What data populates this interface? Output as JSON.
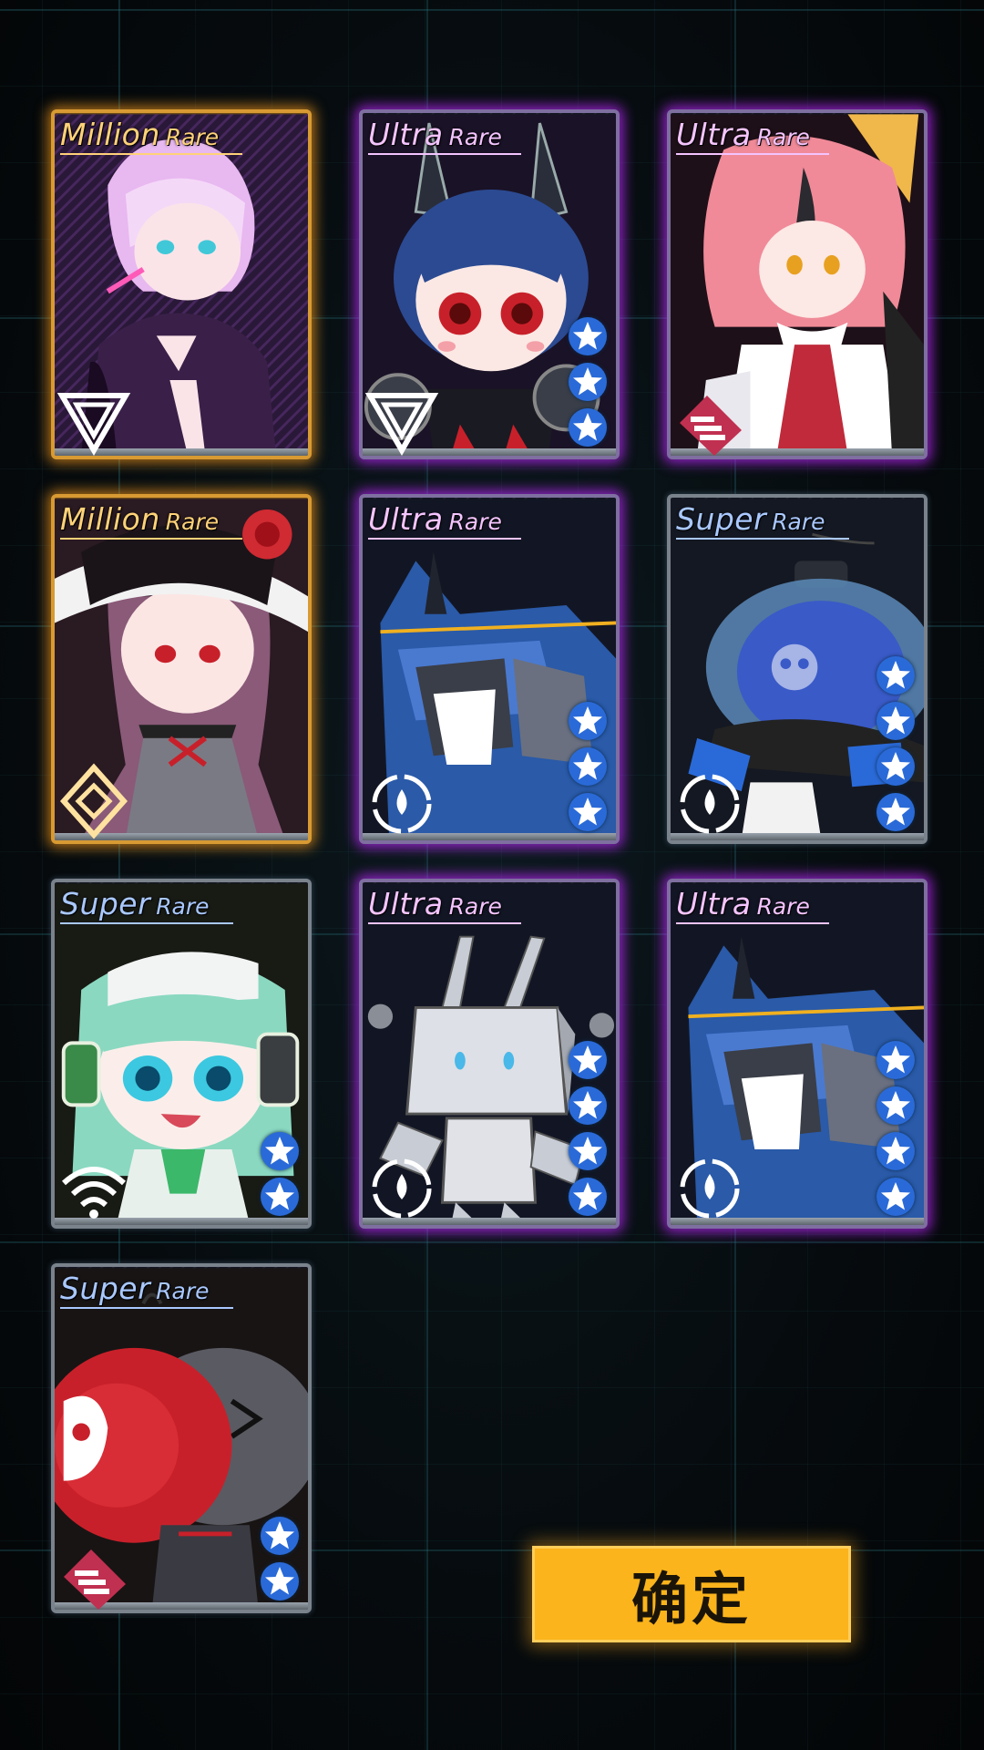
{
  "cards": [
    {
      "rarity_main": "Million",
      "rarity_suffix": "Rare",
      "tier": "million",
      "stars": 0,
      "class_icon": "triangle-class-icon",
      "character": "purple-hair-girl"
    },
    {
      "rarity_main": "Ultra",
      "rarity_suffix": "Rare",
      "tier": "ultra",
      "stars": 3,
      "class_icon": "triangle-class-icon",
      "character": "blue-hair-bunny-girl"
    },
    {
      "rarity_main": "Ultra",
      "rarity_suffix": "Rare",
      "tier": "ultra",
      "stars": 0,
      "class_icon": "stripes-class-icon",
      "character": "pink-hair-fox-girl"
    },
    {
      "rarity_main": "Million",
      "rarity_suffix": "Rare",
      "tier": "million",
      "stars": 0,
      "class_icon": "diamond-class-icon",
      "character": "witch-hat-girl"
    },
    {
      "rarity_main": "Ultra",
      "rarity_suffix": "Rare",
      "tier": "ultra",
      "stars": 3,
      "class_icon": "drop-class-icon",
      "character": "blue-mech"
    },
    {
      "rarity_main": "Super",
      "rarity_suffix": "Rare",
      "tier": "super",
      "stars": 4,
      "class_icon": "drop-class-icon",
      "character": "skull-capsule-bot"
    },
    {
      "rarity_main": "Super",
      "rarity_suffix": "Rare",
      "tier": "super",
      "stars": 2,
      "class_icon": "wifi-class-icon",
      "character": "green-hair-headphone-girl"
    },
    {
      "rarity_main": "Ultra",
      "rarity_suffix": "Rare",
      "tier": "ultra",
      "stars": 4,
      "class_icon": "drop-class-icon",
      "character": "box-head-robot"
    },
    {
      "rarity_main": "Ultra",
      "rarity_suffix": "Rare",
      "tier": "ultra",
      "stars": 4,
      "class_icon": "drop-class-icon",
      "character": "blue-mech"
    },
    {
      "rarity_main": "Super",
      "rarity_suffix": "Rare",
      "tier": "super",
      "stars": 2,
      "class_icon": "stripes-class-icon",
      "character": "red-skull-bomb-bot"
    }
  ],
  "confirm_button": {
    "label": "确定"
  },
  "colors": {
    "million_border": "#d89a32",
    "ultra_glow": "#be28ff",
    "super_text": "#a9c8ff",
    "button": "#fbb41c"
  }
}
